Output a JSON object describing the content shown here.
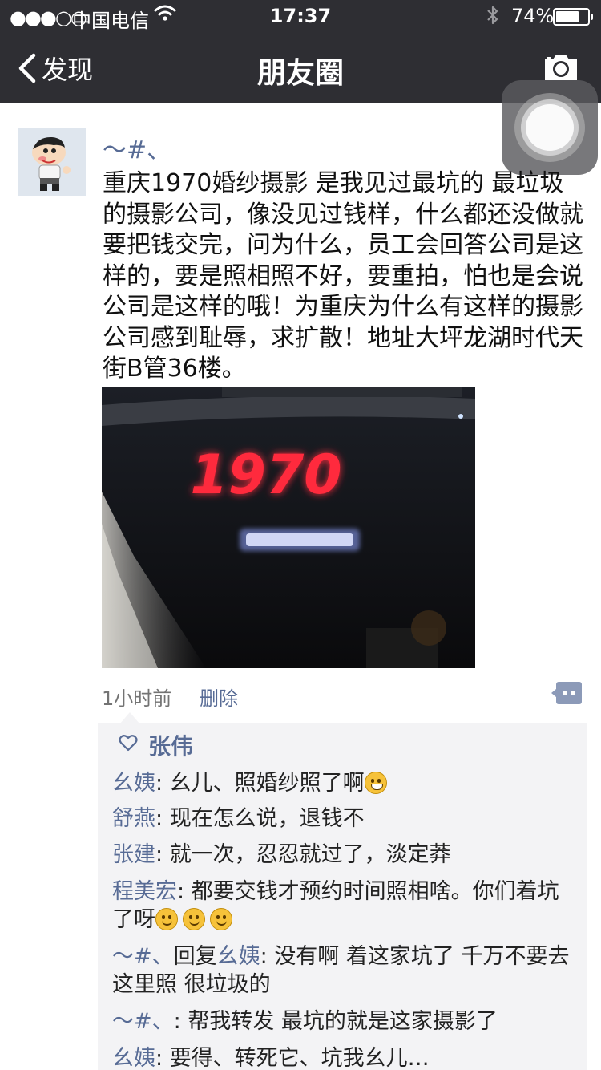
{
  "status_bar": {
    "signal": "●●●○○",
    "carrier": "中国电信",
    "time": "17:37",
    "battery_percent": "74%",
    "battery_level": 0.74
  },
  "nav": {
    "back_label": "发现",
    "title": "朋友圈"
  },
  "post": {
    "username": "～#、",
    "text": "重庆1970婚纱摄影 是我见过最坑的 最垃圾的摄影公司，像没见过钱样，什么都还没做就要把钱交完，问为什么，员工会回答公司是这样的，要是照相照不好，要重拍，怕也是会说公司是这样的哦！为重庆为什么有这样的摄影公司感到耻辱，求扩散！地址大坪龙湖时代天街B管36楼。",
    "image_sign_text": "1970",
    "time_ago": "1小时前",
    "delete_label": "删除"
  },
  "likes": {
    "names": "张伟"
  },
  "comments": [
    {
      "author": "幺姨",
      "separator": ": ",
      "text": "幺儿、照婚纱照了啊",
      "emojis": [
        "grin"
      ]
    },
    {
      "author": "舒燕",
      "separator": ": ",
      "text": "现在怎么说，退钱不",
      "emojis": []
    },
    {
      "author": "张建",
      "separator": ": ",
      "text": "就一次，忍忍就过了，淡定莽",
      "emojis": []
    },
    {
      "author": "程美宏",
      "separator": ": ",
      "text": "都要交钱才预约时间照相啥。你们着坑了呀",
      "emojis": [
        "thinking",
        "thinking",
        "thinking"
      ]
    },
    {
      "author": "～#、",
      "reply_word": "回复",
      "reply_to": "幺姨",
      "separator": ": ",
      "text": "没有啊 着这家坑了 千万不要去这里照 很垃圾的",
      "emojis": []
    },
    {
      "author": "～#、",
      "separator": ": ",
      "text": "帮我转发 最坑的就是这家摄影了",
      "emojis": []
    },
    {
      "author": "幺姨",
      "separator": ": ",
      "text": "要得、转死它、坑我幺儿…",
      "emojis": []
    }
  ],
  "colors": {
    "nav_bg": "#2e2e33",
    "link_blue": "#576b95",
    "comment_bg": "#f3f3f5",
    "sign_red": "#ff2a3c",
    "sign_blue": "#8fa2ff"
  }
}
